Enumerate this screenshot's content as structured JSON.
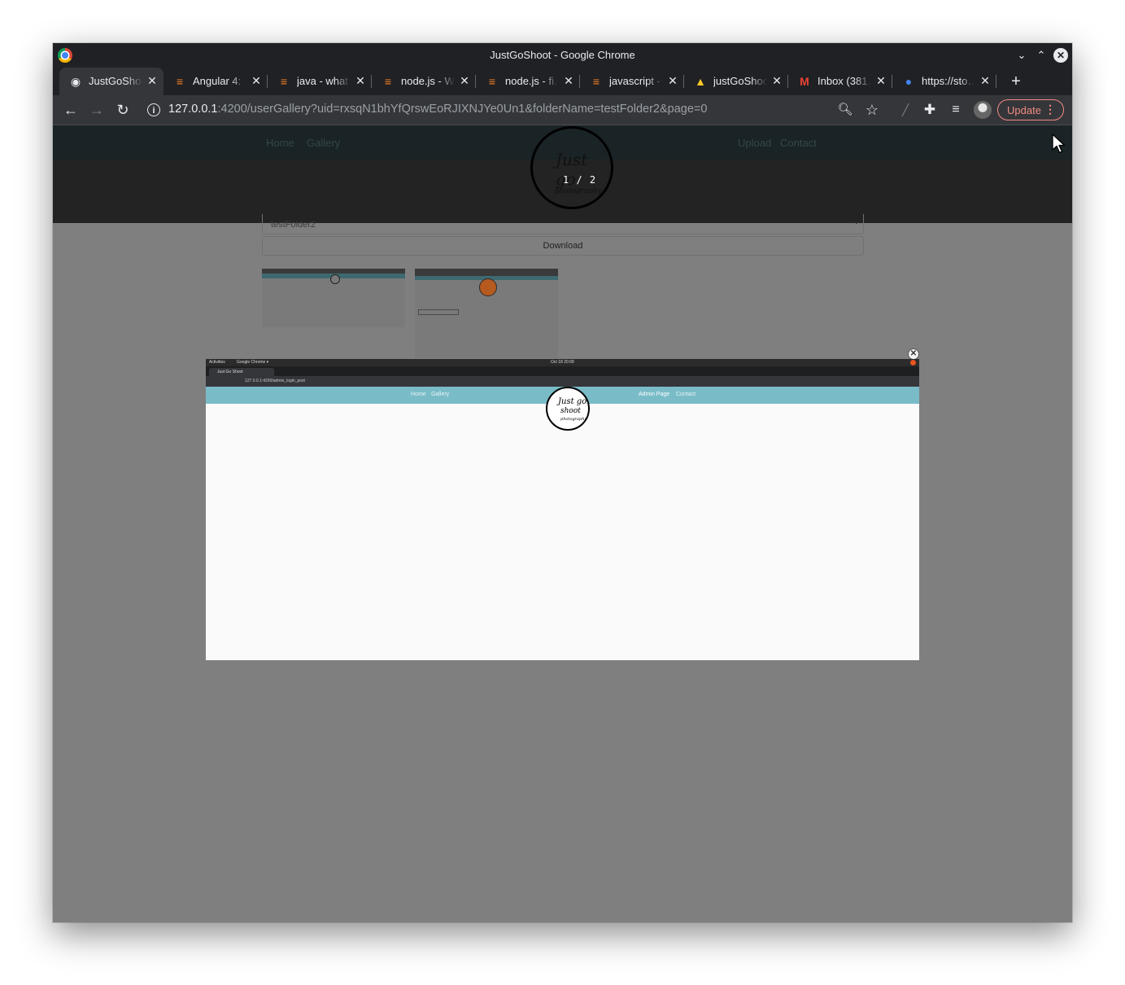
{
  "window": {
    "title": "JustGoShoot - Google Chrome"
  },
  "tabs": [
    {
      "label": "JustGoShoot",
      "icon": "camera-icon",
      "favicon_glyph": "◉",
      "favicon_color": "#e8eaed",
      "active": true
    },
    {
      "label": "Angular 4: …",
      "icon": "stackoverflow-icon",
      "favicon_glyph": "≡",
      "favicon_color": "#f48024",
      "active": false
    },
    {
      "label": "java - what …",
      "icon": "stackoverflow-icon",
      "favicon_glyph": "≡",
      "favicon_color": "#f48024",
      "active": false
    },
    {
      "label": "node.js - W…",
      "icon": "stackoverflow-icon",
      "favicon_glyph": "≡",
      "favicon_color": "#f48024",
      "active": false
    },
    {
      "label": "node.js - fi…",
      "icon": "stackoverflow-icon",
      "favicon_glyph": "≡",
      "favicon_color": "#f48024",
      "active": false
    },
    {
      "label": "javascript - …",
      "icon": "stackoverflow-icon",
      "favicon_glyph": "≡",
      "favicon_color": "#f48024",
      "active": false
    },
    {
      "label": "justGoShoot",
      "icon": "firebase-icon",
      "favicon_glyph": "▲",
      "favicon_color": "#ffca28",
      "active": false
    },
    {
      "label": "Inbox (381…",
      "icon": "gmail-icon",
      "favicon_glyph": "M",
      "favicon_color": "#ea4335",
      "active": false
    },
    {
      "label": "https://sto…",
      "icon": "google-docs-icon",
      "favicon_glyph": "●",
      "favicon_color": "#4285f4",
      "active": false
    }
  ],
  "toolbar": {
    "url_host": "127.0.0.1",
    "url_rest": ":4200/userGallery?uid=rxsqN1bhYfQrswEoRJIXNJYe0Un1&folderName=testFolder2&page=0",
    "update_label": "Update"
  },
  "site": {
    "nav_left": [
      "Home",
      "Gallery"
    ],
    "nav_right": [
      "Upload",
      "Contact"
    ],
    "logo_line1": "Just go",
    "logo_line2": "photography",
    "lightbox_counter": "1 / 2",
    "folder_select_value": "testFolder2",
    "download_label": "Download"
  },
  "modal": {
    "inner_topbar_left": "Activities",
    "inner_topbar_app": "Google Chrome ▾",
    "inner_topbar_clock": "Oct 18  20:09",
    "inner_tab_title": "Just Go Shoot",
    "inner_url": "127.0.0.1:4200/admin_login_post",
    "inner_nav_left": [
      "Home",
      "Gallery"
    ],
    "inner_nav_right": [
      "Admin Page",
      "Contact"
    ],
    "inner_logo_line1": "Just go",
    "inner_logo_line2": "shoot",
    "inner_logo_line3": "photography"
  },
  "colors": {
    "browser_frame": "#202124",
    "toolbar": "#35363a",
    "page_dim": "#7f7f7f",
    "inner_nav": "#79bcc8",
    "update_accent": "#f28b82"
  }
}
